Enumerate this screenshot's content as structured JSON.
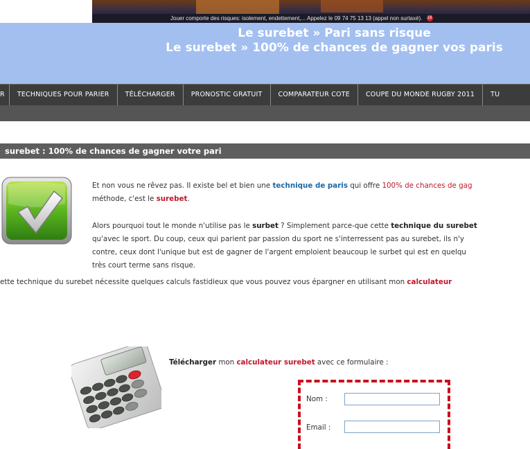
{
  "banner": {
    "warning_text": "Jouer comporte des risques: isolement, endettement,...    Appelez le 09 74 75 13 13 (appel non surtaxé).",
    "age_badge": "18"
  },
  "header": {
    "title_line1": "Le surebet » Pari sans risque",
    "title_line2": "Le surebet » 100% de chances de gagner vos paris"
  },
  "nav": {
    "items": [
      "R",
      "TECHNIQUES POUR PARIER",
      "TÉLÉCHARGER",
      "PRONOSTIC GRATUIT",
      "COMPARATEUR COTE",
      "COUPE DU MONDE RUGBY 2011",
      "TU"
    ]
  },
  "section": {
    "title": "surebet : 100% de chances de gagner votre pari"
  },
  "paragraph1": {
    "a": "Et non vous ne rêvez pas. Il existe bel et bien une ",
    "link1": "technique de paris",
    "b": " qui offre ",
    "link2": "100% de chances de gag",
    "c": "méthode, c'est le ",
    "link3": "surebet",
    "d": "."
  },
  "paragraph2": {
    "a": "Alors pourquoi tout le monde n'utilise pas le ",
    "b1": "surbet",
    "b": " ? Simplement parce-que cette ",
    "b2": "technique du surebet",
    "line2": "qu'avec le sport. Du coup, ceux qui parient par passion du sport ne s'interressent pas au surebet, ils n'y",
    "line3": "contre, ceux dont l'unique but est de gagner de l'argent emploient beaucoup le surbet qui est en quelqu",
    "line4": "très court terme sans risque."
  },
  "paragraph3": {
    "a": "ette technique du surebet nécessite quelques calculs fastidieux que vous pouvez vous épargner en utilisant mon ",
    "link": "calculateur"
  },
  "download": {
    "bold": "Télécharger",
    "mid": " mon ",
    "link": "calculateur surebet",
    "end": " avec ce formulaire :"
  },
  "form": {
    "nom_label": "Nom :",
    "email_label": "Email :",
    "nom_value": "",
    "email_value": ""
  },
  "icons": {
    "checkmark": "checkmark-icon",
    "calculator": "calculator-image"
  },
  "colors": {
    "header_bg": "#a2bff0",
    "nav_bg": "#3c3c3c",
    "section_bar": "#5e5e5e",
    "link_blue": "#1e66a8",
    "link_red": "#c0172b",
    "form_border": "#c8101c"
  }
}
